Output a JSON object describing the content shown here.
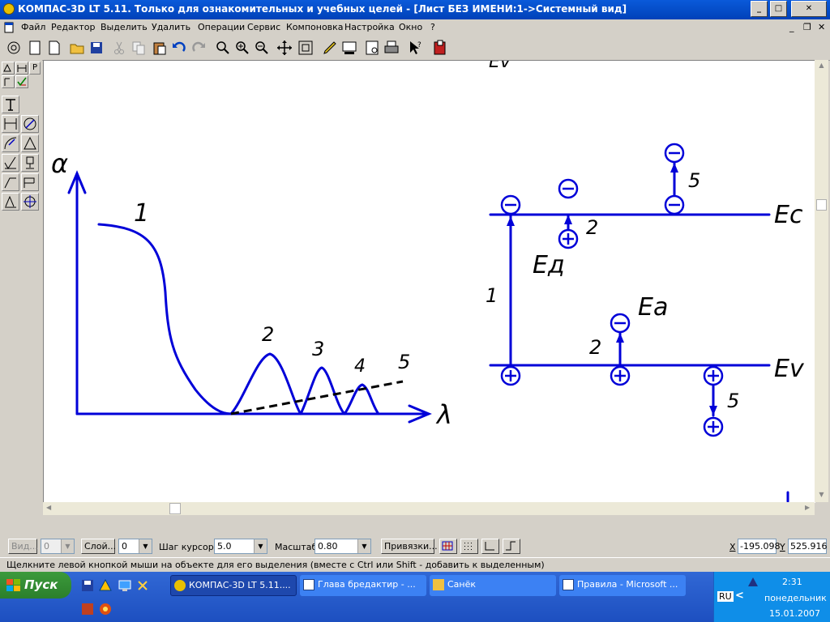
{
  "window": {
    "title": "КОМПАС-3D LT 5.11. Только для ознакомительных и учебных целей - [Лист БЕЗ ИМЕНИ:1->Системный вид]",
    "min_label": "_",
    "max_label": "□",
    "close_label": "✕"
  },
  "menu": {
    "items": [
      "Файл",
      "Редактор",
      "Выделить",
      "Удалить",
      "Операции",
      "Сервис",
      "Компоновка",
      "Настройка",
      "Окно",
      "?"
    ],
    "mdi": {
      "min": "_",
      "restore": "❐",
      "close": "✕"
    }
  },
  "left_panel": {
    "tabs": [
      "Р"
    ]
  },
  "drawing": {
    "graph": {
      "y_axis_label": "α",
      "x_axis_label": "λ",
      "curve_labels": [
        "1",
        "2",
        "3",
        "4",
        "5"
      ]
    },
    "band": {
      "ec": "Eс",
      "ev": "Ev",
      "ed": "Eд",
      "ea": "Eа",
      "top_partial": "Ev",
      "labels": [
        "5",
        "2",
        "1",
        "2",
        "5"
      ],
      "signs": {
        "minus": "−",
        "plus": "+"
      }
    }
  },
  "properties_bar": {
    "view_label": "Вид...",
    "view_value": "0",
    "layer_label": "Слой...",
    "layer_value": "0",
    "step_label": "Шаг курсора",
    "step_value": "5.0",
    "scale_label": "Масштаб",
    "scale_value": "0.80",
    "snap_label": "Привязки...",
    "x_label": "X",
    "x_value": "-195.098",
    "y_label": "Y",
    "y_value": "525.916"
  },
  "status": {
    "text": "Щелкните левой кнопкой мыши на объекте для его выделения (вместе с Ctrl или Shift - добавить к выделенным)"
  },
  "taskbar": {
    "start": "Пуск",
    "tasks": [
      "КОМПАС-3D LT 5.11....",
      "Глава бредактир - ...",
      "Санёк",
      "Правила - Microsoft ..."
    ],
    "lang": "RU",
    "time": "2:31",
    "day": "понедельник",
    "date": "15.01.2007"
  },
  "colors": {
    "drawing": "#0000d8",
    "title_bg": "#0a5ada",
    "taskbar": "#245edb",
    "start": "#3c9a3c"
  }
}
